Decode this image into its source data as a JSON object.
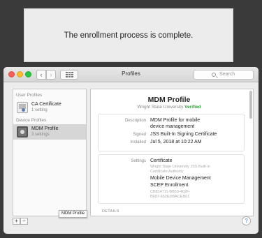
{
  "banner": {
    "message": "The enrollment process is complete."
  },
  "window": {
    "title": "Profiles",
    "search_placeholder": "Search"
  },
  "sidebar": {
    "user_profiles_header": "User Profiles",
    "device_profiles_header": "Device Profiles",
    "items": [
      {
        "name": "CA Certificate",
        "subtitle": "1 setting",
        "icon": "certificate-icon"
      },
      {
        "name": "MDM Profile",
        "subtitle": "3 settings",
        "icon": "gear-icon",
        "selected": true
      }
    ],
    "tooltip": "MDM Profile",
    "add_label": "+",
    "remove_label": "−"
  },
  "profile": {
    "title": "MDM Profile",
    "organization": "Wright State University",
    "status": "Verified",
    "status_color": "#2f9b3a",
    "description_label": "Description",
    "description_line1": "MDM Profile for mobile",
    "description_line2": "device management",
    "signed_label": "Signed",
    "signed_value": "JSS Built-In Signing Certificate",
    "installed_label": "Installed",
    "installed_value": "Jul 5, 2018 at 10:22 AM",
    "settings_label": "Settings",
    "settings": {
      "certificate": "Certificate",
      "certificate_sub1": "Wright State University JSS Built-in",
      "certificate_sub2": "Certificate Authority",
      "mdm": "Mobile Device Management",
      "scep": "SCEP Enrollment",
      "scep_id1": "CB814711-BB53-402F-",
      "scep_id2": "B687-652EDBACEB01"
    },
    "details_label": "DETAILS"
  },
  "help_label": "?"
}
